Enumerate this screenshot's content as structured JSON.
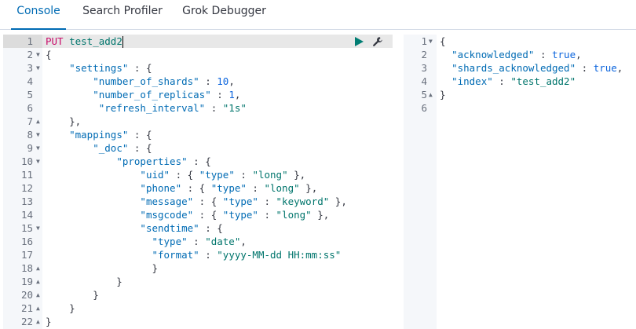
{
  "tabs": [
    {
      "label": "Console",
      "active": true
    },
    {
      "label": "Search Profiler",
      "active": false
    },
    {
      "label": "Grok Debugger",
      "active": false
    }
  ],
  "request": {
    "method": "PUT",
    "url": "test_add2",
    "lines": [
      {
        "n": "1",
        "fold": "",
        "tokens": [
          [
            "kw-method",
            "PUT"
          ],
          [
            "p",
            " "
          ],
          [
            "kw-url",
            "test_add2"
          ]
        ]
      },
      {
        "n": "2",
        "fold": "▼",
        "tokens": [
          [
            "p",
            "{"
          ]
        ]
      },
      {
        "n": "3",
        "fold": "▼",
        "tokens": [
          [
            "p",
            "    "
          ],
          [
            "k",
            "\"settings\""
          ],
          [
            "p",
            " : {"
          ]
        ]
      },
      {
        "n": "4",
        "fold": "",
        "tokens": [
          [
            "p",
            "        "
          ],
          [
            "k",
            "\"number_of_shards\""
          ],
          [
            "p",
            " : "
          ],
          [
            "n",
            "10"
          ],
          [
            "p",
            ","
          ]
        ]
      },
      {
        "n": "5",
        "fold": "",
        "tokens": [
          [
            "p",
            "        "
          ],
          [
            "k",
            "\"number_of_replicas\""
          ],
          [
            "p",
            " : "
          ],
          [
            "n",
            "1"
          ],
          [
            "p",
            ","
          ]
        ]
      },
      {
        "n": "6",
        "fold": "",
        "tokens": [
          [
            "p",
            "         "
          ],
          [
            "k",
            "\"refresh_interval\""
          ],
          [
            "p",
            " : "
          ],
          [
            "s",
            "\"1s\""
          ]
        ]
      },
      {
        "n": "7",
        "fold": "▲",
        "tokens": [
          [
            "p",
            "    },"
          ]
        ]
      },
      {
        "n": "8",
        "fold": "▼",
        "tokens": [
          [
            "p",
            "    "
          ],
          [
            "k",
            "\"mappings\""
          ],
          [
            "p",
            " : {"
          ]
        ]
      },
      {
        "n": "9",
        "fold": "▼",
        "tokens": [
          [
            "p",
            "        "
          ],
          [
            "k",
            "\"_doc\""
          ],
          [
            "p",
            " : {"
          ]
        ]
      },
      {
        "n": "10",
        "fold": "▼",
        "tokens": [
          [
            "p",
            "            "
          ],
          [
            "k",
            "\"properties\""
          ],
          [
            "p",
            " : {"
          ]
        ]
      },
      {
        "n": "11",
        "fold": "",
        "tokens": [
          [
            "p",
            "                "
          ],
          [
            "k",
            "\"uid\""
          ],
          [
            "p",
            " : { "
          ],
          [
            "k",
            "\"type\""
          ],
          [
            "p",
            " : "
          ],
          [
            "s",
            "\"long\""
          ],
          [
            "p",
            " },"
          ]
        ]
      },
      {
        "n": "12",
        "fold": "",
        "tokens": [
          [
            "p",
            "                "
          ],
          [
            "k",
            "\"phone\""
          ],
          [
            "p",
            " : { "
          ],
          [
            "k",
            "\"type\""
          ],
          [
            "p",
            " : "
          ],
          [
            "s",
            "\"long\""
          ],
          [
            "p",
            " },"
          ]
        ]
      },
      {
        "n": "13",
        "fold": "",
        "tokens": [
          [
            "p",
            "                "
          ],
          [
            "k",
            "\"message\""
          ],
          [
            "p",
            " : { "
          ],
          [
            "k",
            "\"type\""
          ],
          [
            "p",
            " : "
          ],
          [
            "s",
            "\"keyword\""
          ],
          [
            "p",
            " },"
          ]
        ]
      },
      {
        "n": "14",
        "fold": "",
        "tokens": [
          [
            "p",
            "                "
          ],
          [
            "k",
            "\"msgcode\""
          ],
          [
            "p",
            " : { "
          ],
          [
            "k",
            "\"type\""
          ],
          [
            "p",
            " : "
          ],
          [
            "s",
            "\"long\""
          ],
          [
            "p",
            " },"
          ]
        ]
      },
      {
        "n": "15",
        "fold": "▼",
        "tokens": [
          [
            "p",
            "                "
          ],
          [
            "k",
            "\"sendtime\""
          ],
          [
            "p",
            " : {"
          ]
        ]
      },
      {
        "n": "16",
        "fold": "",
        "tokens": [
          [
            "p",
            "                  "
          ],
          [
            "k",
            "\"type\""
          ],
          [
            "p",
            " : "
          ],
          [
            "s",
            "\"date\""
          ],
          [
            "p",
            ","
          ]
        ]
      },
      {
        "n": "17",
        "fold": "",
        "tokens": [
          [
            "p",
            "                  "
          ],
          [
            "k",
            "\"format\""
          ],
          [
            "p",
            " : "
          ],
          [
            "s",
            "\"yyyy-MM-dd HH:mm:ss\""
          ]
        ]
      },
      {
        "n": "18",
        "fold": "▲",
        "tokens": [
          [
            "p",
            "                  }"
          ]
        ]
      },
      {
        "n": "19",
        "fold": "▲",
        "tokens": [
          [
            "p",
            "            }"
          ]
        ]
      },
      {
        "n": "20",
        "fold": "▲",
        "tokens": [
          [
            "p",
            "        }"
          ]
        ]
      },
      {
        "n": "21",
        "fold": "▲",
        "tokens": [
          [
            "p",
            "    }"
          ]
        ]
      },
      {
        "n": "22",
        "fold": "▲",
        "tokens": [
          [
            "p",
            "}"
          ]
        ]
      }
    ]
  },
  "response": {
    "lines": [
      {
        "n": "1",
        "fold": "▼",
        "tokens": [
          [
            "p",
            "{"
          ]
        ]
      },
      {
        "n": "2",
        "fold": "",
        "tokens": [
          [
            "p",
            "  "
          ],
          [
            "k",
            "\"acknowledged\""
          ],
          [
            "p",
            " : "
          ],
          [
            "n",
            "true"
          ],
          [
            "p",
            ","
          ]
        ]
      },
      {
        "n": "3",
        "fold": "",
        "tokens": [
          [
            "p",
            "  "
          ],
          [
            "k",
            "\"shards_acknowledged\""
          ],
          [
            "p",
            " : "
          ],
          [
            "n",
            "true"
          ],
          [
            "p",
            ","
          ]
        ]
      },
      {
        "n": "4",
        "fold": "",
        "tokens": [
          [
            "p",
            "  "
          ],
          [
            "k",
            "\"index\""
          ],
          [
            "p",
            " : "
          ],
          [
            "s",
            "\"test_add2\""
          ]
        ]
      },
      {
        "n": "5",
        "fold": "▲",
        "tokens": [
          [
            "p",
            "}"
          ]
        ]
      },
      {
        "n": "6",
        "fold": "",
        "tokens": []
      }
    ]
  },
  "icons": {
    "run": "play-icon",
    "settings": "wrench-icon"
  },
  "colors": {
    "accent": "#006bb4",
    "run": "#017d73",
    "method": "#c80a68",
    "string": "#00756c",
    "key": "#006bb4",
    "number": "#0b64dd"
  }
}
